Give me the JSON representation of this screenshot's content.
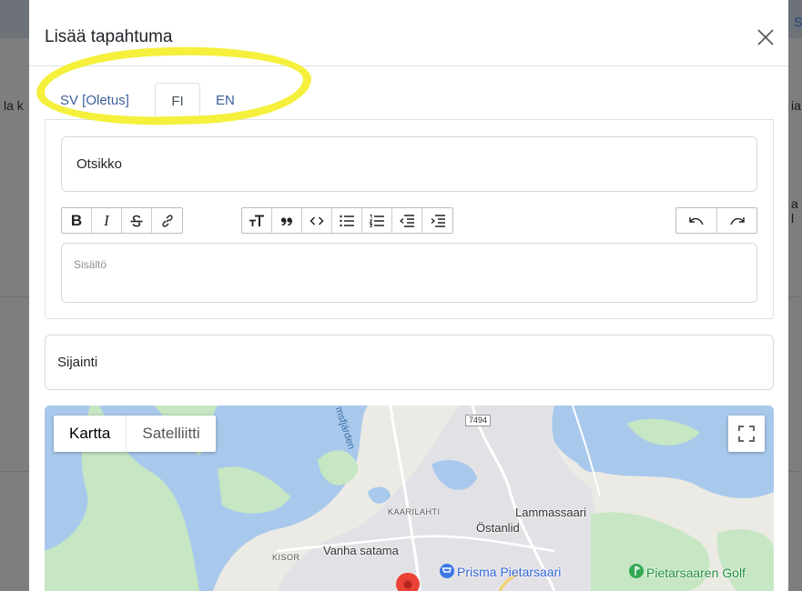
{
  "background": {
    "left_snippet": "la k",
    "right_snippet_top": "S",
    "right_snippet_mid": "ia",
    "right_snippet_low": "a l"
  },
  "modal": {
    "title": "Lisää tapahtuma",
    "close_icon": "close-icon"
  },
  "tabs": [
    {
      "label": "SV [Oletus]",
      "active": false
    },
    {
      "label": "FI",
      "active": true
    },
    {
      "label": "EN",
      "active": false
    }
  ],
  "form": {
    "title_placeholder": "Otsikko",
    "content_placeholder": "Sisältö",
    "location_placeholder": "Sijainti"
  },
  "toolbar": {
    "groups": [
      [
        "bold-icon",
        "italic-icon",
        "strikethrough-icon",
        "link-icon"
      ],
      [
        "heading-icon",
        "quote-icon",
        "code-icon",
        "bullet-list-icon",
        "numbered-list-icon",
        "outdent-icon",
        "indent-icon"
      ],
      [
        "undo-icon",
        "redo-icon"
      ]
    ],
    "bold_label": "B",
    "italic_label": "I"
  },
  "map": {
    "type_buttons": [
      "Kartta",
      "Satelliitti"
    ],
    "active_type": "Kartta",
    "road_number": "7494",
    "labels": {
      "kaarilahti": "KAARILAHTI",
      "lammassaari": "Lammassaari",
      "ostanlid": "Östanlid",
      "vanha_satama": "Vanha satama",
      "kisor": "KISOR",
      "prisma": "Prisma Pietarsaari",
      "golf": "Pietarsaaren Golf",
      "fjarden": "msfjärden"
    },
    "colors": {
      "water": "#a9c9ec",
      "land": "#eceae4",
      "green": "#c6e6c4",
      "urban": "#e2e2e6",
      "pin": "#ea4335"
    }
  },
  "highlight_color": "#f4f03c"
}
